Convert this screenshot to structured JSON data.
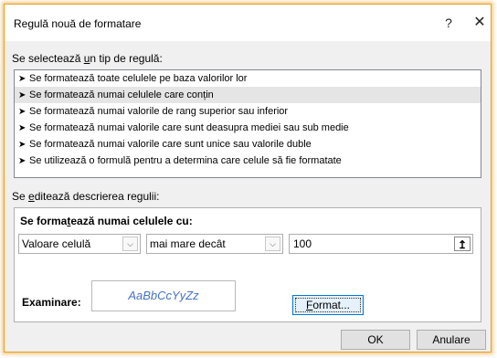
{
  "window": {
    "title": "Regulă nouă de formatare",
    "help_glyph": "?",
    "close_glyph": "✕"
  },
  "rule_type": {
    "label_pre": "Se selectează ",
    "label_ul": "u",
    "label_post": "n tip de regulă:",
    "items": [
      "Se formatează toate celulele pe baza valorilor lor",
      "Se formatează numai celulele care conțin",
      "Se formatează numai valorile de rang superior sau inferior",
      "Se formatează numai valorile care sunt deasupra mediei sau sub medie",
      "Se formatează numai valorile care sunt unice sau valorile duble",
      "Se utilizează o formulă pentru a determina care celule să fie formatate"
    ],
    "selected_index": 1,
    "bullet": "➤"
  },
  "description": {
    "label_pre": "Se ",
    "label_ul": "e",
    "label_post": "ditează descrierea regulii:",
    "heading_pre": "Se forma",
    "heading_ul": "t",
    "heading_post": "ează numai celulele cu:",
    "combo1_value": "Valoare celulă",
    "combo2_value": "mai mare decât",
    "value_field": "100",
    "preview_label": "Examinare:",
    "preview_text": "AaBbCcYyZz",
    "format_button_ul": "F",
    "format_button_post": "ormat..."
  },
  "buttons": {
    "ok": "OK",
    "cancel": "Anulare"
  },
  "colors": {
    "accent": "#e6a021",
    "preview_text": "#4472c4",
    "selected_row": "#e5e5e5"
  }
}
